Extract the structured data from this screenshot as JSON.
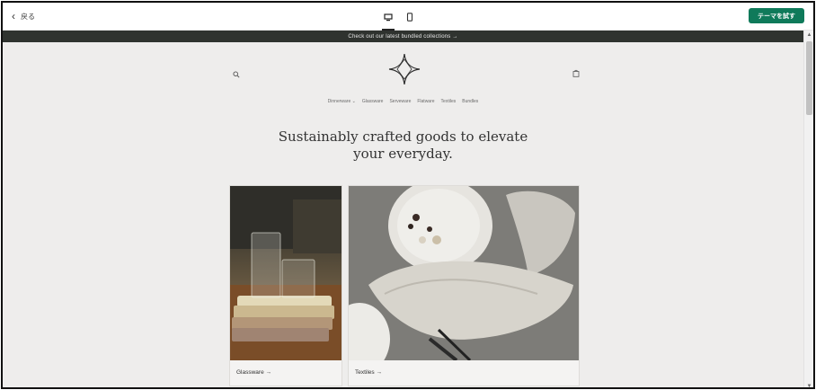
{
  "editor": {
    "back_label": "戻る",
    "try_theme_label": "テーマを試す",
    "accent_color": "#0f7a5a",
    "devices": [
      {
        "name": "desktop",
        "icon": "desktop-icon",
        "active": true
      },
      {
        "name": "mobile",
        "icon": "mobile-icon",
        "active": false
      }
    ]
  },
  "store": {
    "announcement": "Check out our latest bundled collections  →",
    "nav": [
      "Dinnerware ⌄",
      "Glassware",
      "Serveware",
      "Flatware",
      "Textiles",
      "Bundles"
    ],
    "headline_line1": "Sustainably crafted goods to elevate",
    "headline_line2": "your everyday.",
    "collections": [
      {
        "label": "Glassware →"
      },
      {
        "label": "Textiles →"
      }
    ],
    "icons": [
      "search-icon",
      "cart-icon",
      "logo-icon"
    ]
  }
}
